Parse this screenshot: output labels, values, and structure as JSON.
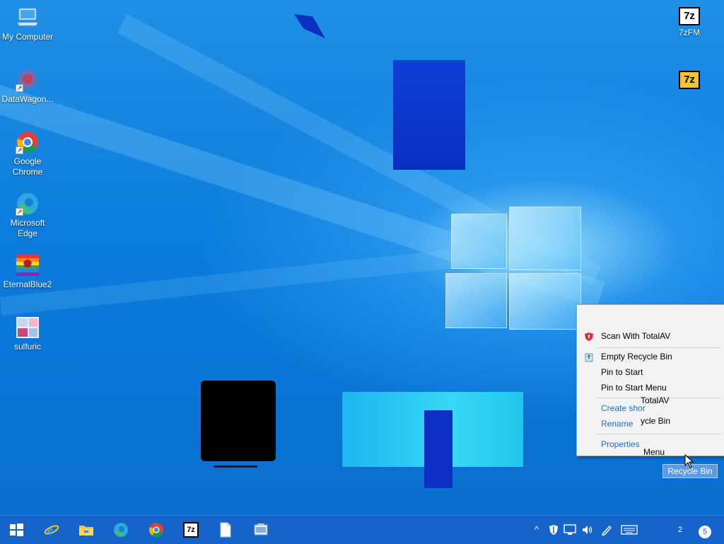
{
  "desktop": {
    "icons_left": [
      {
        "label": "My Computer"
      },
      {
        "label": "DataWagon..."
      },
      {
        "label": "Google Chrome"
      },
      {
        "label": "Microsoft Edge"
      },
      {
        "label": "EternalBlue2"
      },
      {
        "label": "sulfuric"
      }
    ],
    "icons_right": [
      {
        "label": "7zFM",
        "glyph": "7z"
      },
      {
        "label": "",
        "glyph": "7z"
      }
    ],
    "recycle_bin_label": "Recycle Bin"
  },
  "context_menu": {
    "items": [
      {
        "label": "Scan With TotalAV",
        "icon": "shield-icon",
        "icon_color": "#d9313b"
      },
      {
        "label": "Empty Recycle Bin",
        "icon": "recycle-icon"
      },
      {
        "label": "Pin to Start"
      },
      {
        "label": "Pin to Start Menu"
      },
      {
        "label": "Create shortcut",
        "visible_text": "Create shor"
      },
      {
        "label": "Rename"
      },
      {
        "label": "Properties"
      }
    ],
    "ghost_text": [
      "TotalAV",
      "ycle Bin",
      "Menu"
    ]
  },
  "taskbar": {
    "pinned": [
      {
        "name": "start-button",
        "icon": "windows-logo-icon"
      },
      {
        "name": "internet-explorer",
        "icon": "ie-icon"
      },
      {
        "name": "file-explorer",
        "icon": "folder-icon"
      },
      {
        "name": "edge",
        "icon": "edge-icon"
      },
      {
        "name": "chrome",
        "icon": "chrome-icon"
      },
      {
        "name": "7zip",
        "icon": "7z-icon",
        "glyph": "7z"
      },
      {
        "name": "notepad-file",
        "icon": "file-icon"
      },
      {
        "name": "app",
        "icon": "app-icon"
      }
    ],
    "tray": {
      "chevron": "^",
      "notification_count": "5",
      "clock_fragment": "2"
    }
  },
  "colors": {
    "accent": "#0a78d4",
    "taskbar": "#1564c9",
    "menu_bg": "#f2f2f2",
    "menu_link": "#1a6fd0"
  }
}
